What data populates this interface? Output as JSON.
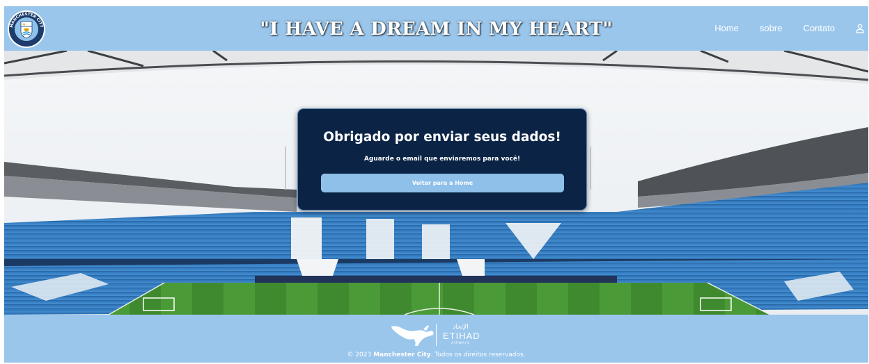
{
  "header": {
    "title": "\"I HAVE A DREAM IN MY HEART\"",
    "logo_text": "MANCHESTER CITY",
    "nav": [
      {
        "label": "Home"
      },
      {
        "label": "sobre"
      },
      {
        "label": "Contato"
      }
    ]
  },
  "dialog": {
    "title": "Obrigado por enviar seus dados!",
    "subtitle": "Aguarde o email que enviaremos para você!",
    "button_label": "Voltar para a Home"
  },
  "footer": {
    "sponsor_arabic": "الإتحاد",
    "sponsor_name": "ETIHAD",
    "sponsor_tagline": "AIRWAYS",
    "copyright_prefix": "© 2023 ",
    "copyright_brand": "Manchester City",
    "copyright_suffix": ". Todos os direitos reservados."
  },
  "icons": {
    "logo": "manchester-city-crest-icon",
    "user": "user-icon",
    "puma": "puma-logo-icon",
    "etihad": "etihad-logo-icon"
  },
  "colors": {
    "header_bg": "#9ac6ec",
    "dialog_bg": "#0b2446",
    "button_bg": "#8fc0ea",
    "seat_blue": "#3a86cd",
    "pitch_green": "#3f8a2f"
  }
}
